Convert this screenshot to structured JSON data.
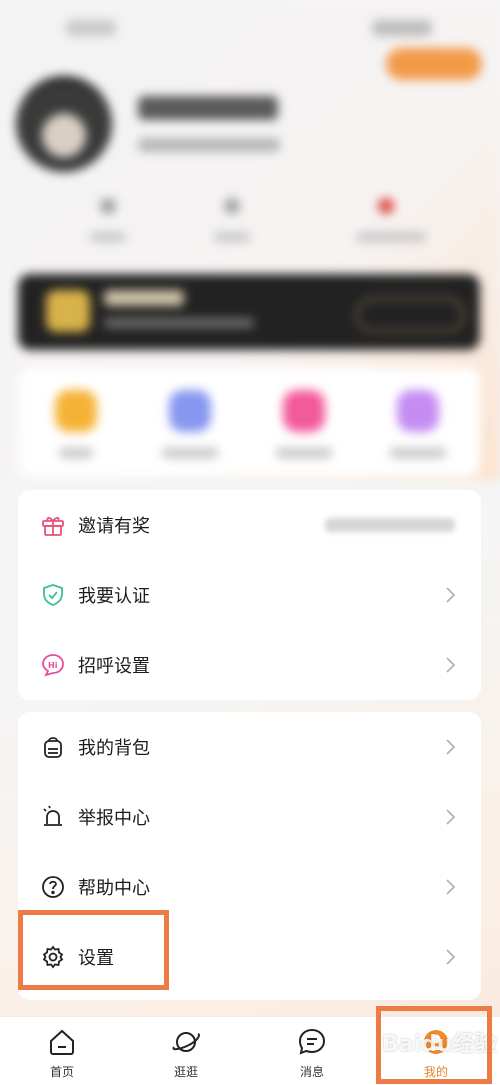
{
  "menu_group1": [
    {
      "label": "邀请有奖",
      "icon": "gift-icon"
    },
    {
      "label": "我要认证",
      "icon": "shield-check-icon"
    },
    {
      "label": "招呼设置",
      "icon": "hi-bubble-icon"
    }
  ],
  "menu_group2": [
    {
      "label": "我的背包",
      "icon": "backpack-icon"
    },
    {
      "label": "举报中心",
      "icon": "alarm-bell-icon"
    },
    {
      "label": "帮助中心",
      "icon": "question-circle-icon"
    },
    {
      "label": "设置",
      "icon": "gear-icon"
    }
  ],
  "tabbar": [
    {
      "label": "首页",
      "icon": "home-icon"
    },
    {
      "label": "逛逛",
      "icon": "planet-icon"
    },
    {
      "label": "消息",
      "icon": "chat-bubble-icon"
    },
    {
      "label": "我的",
      "icon": "profile-avatar-icon",
      "active": true
    }
  ],
  "watermark": "Baidu经验",
  "colors": {
    "accent": "#e2862f",
    "highlight": "#ee7a46",
    "gift": "#e8527a",
    "shield": "#3cbf9a",
    "hi": "#e24ea0"
  }
}
